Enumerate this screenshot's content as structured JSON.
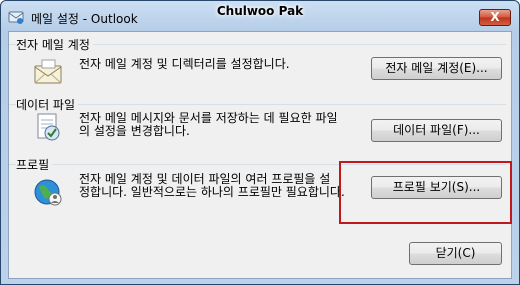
{
  "window": {
    "title": "메일 설정 - Outlook",
    "user_name": "Chulwoo Pak",
    "close_label": "X",
    "app_icon": "outlook-mail-icon"
  },
  "sections": {
    "email_accounts": {
      "label": "전자 메일 계정",
      "desc": [
        "전자 메일 계정 및 디렉터리를 설정합니다."
      ],
      "button": "전자 메일 계정(E)...",
      "icon": "email-envelope-icon"
    },
    "data_files": {
      "label": "데이터 파일",
      "desc": [
        "전자 메일 메시지와 문서를 저장하는 데 필요한 파일",
        "의 설정을 변경합니다."
      ],
      "button": "데이터 파일(F)...",
      "icon": "data-file-icon"
    },
    "profiles": {
      "label": "프로필",
      "desc": [
        "전자 메일 계정 및 데이터 파일의 여러 프로필을 설",
        "정합니다. 일반적으로는 하나의 프로필만 필요합니다."
      ],
      "button": "프로필 보기(S)...",
      "icon": "profile-globe-icon"
    }
  },
  "footer": {
    "close_button": "닫기(C)"
  },
  "highlight_color": "#c0191d"
}
